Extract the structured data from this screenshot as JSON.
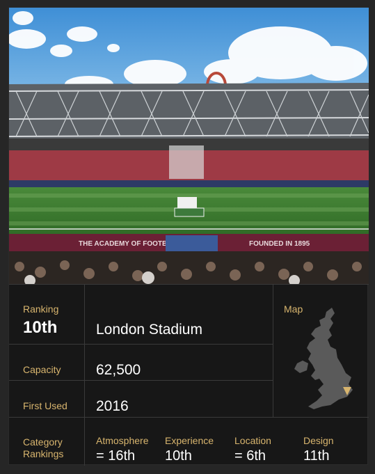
{
  "ranking": {
    "label": "Ranking",
    "value": "10th"
  },
  "stadium": {
    "name": "London Stadium"
  },
  "capacity": {
    "label": "Capacity",
    "value": "62,500"
  },
  "first_used": {
    "label": "First Used",
    "value": "2016"
  },
  "map": {
    "label": "Map",
    "icon": "uk-map-marker-icon"
  },
  "category_rankings": {
    "label_line1": "Category",
    "label_line2": "Rankings",
    "items": [
      {
        "label": "Atmosphere",
        "value": "= 16th"
      },
      {
        "label": "Experience",
        "value": "10th"
      },
      {
        "label": "Location",
        "value": "= 6th"
      },
      {
        "label": "Design",
        "value": "11th"
      }
    ]
  },
  "photo": {
    "banner_left": "THE ACADEMY OF FOOTBALL",
    "banner_right": "FOUNDED IN 1895"
  },
  "colors": {
    "accent": "#d8b56e",
    "background": "#171717",
    "divider": "#3a3a3a"
  }
}
